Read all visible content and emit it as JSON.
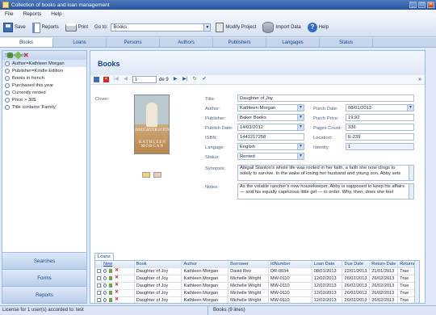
{
  "window": {
    "title": "Collection of books and loan management"
  },
  "menu": [
    "File",
    "Reports",
    "Help"
  ],
  "toolbar": {
    "save": "Save",
    "reports": "Reports",
    "print": "Print",
    "goto_label": "Go to:",
    "goto_value": "Books",
    "modify_project": "Modify Project",
    "import_data": "Import Data",
    "help": "Help"
  },
  "tabs": [
    "Books",
    "Loans",
    "Persons",
    "Authors",
    "Publishers",
    "Langages",
    "Status"
  ],
  "active_tab": "Books",
  "shortcuts": {
    "title": "ShortCuts",
    "items": [
      "Author=Kathleen Morgan",
      "Publisher=Kindle Edition",
      "Books in french",
      "Purchased this year",
      "Currently rented",
      "Price > 30$",
      "Title contains 'Family'"
    ],
    "selected_index": 0
  },
  "side_buttons": {
    "searches": "Searches",
    "forms": "Forms",
    "reports": "Reports"
  },
  "panel": {
    "title": "Books"
  },
  "nav": {
    "page": "1",
    "of": "de 9"
  },
  "book": {
    "cover_label": "Cover:",
    "cover_title_text": "DAUGHTER of JOY",
    "cover_author_text": "KATHLEEN MORGAN",
    "fields": {
      "title": {
        "label": "Title:",
        "value": "Daughter of Joy"
      },
      "author": {
        "label": "Author:",
        "value": "Kathleen Morgan"
      },
      "publisher": {
        "label": "Publisher:",
        "value": "Baker Books"
      },
      "publish_date": {
        "label": "Publish Date:",
        "value": "14/03/2012"
      },
      "isbn": {
        "label": "ISBN:",
        "value": "1441217258"
      },
      "language": {
        "label": "Langage:",
        "value": "English"
      },
      "status": {
        "label": "Status:",
        "value": "Rented"
      },
      "purch_date": {
        "label": "Purch Date:",
        "value": "08/01/2013"
      },
      "purch_price": {
        "label": "Purch Price:",
        "value": "19,92"
      },
      "pages_count": {
        "label": "Pages Count:",
        "value": "336"
      },
      "location": {
        "label": "Location:",
        "value": "E-239"
      },
      "identity": {
        "label": "Identity:",
        "value": "1"
      },
      "synopsis": {
        "label": "Synopsis:",
        "value": "Abigail Stanton's whole life was rooted in her faith, a faith she now clings to solely to survive. In the wake of losing her husband and young son, Abby sets"
      },
      "notes": {
        "label": "Notes:",
        "value": "As the volatile rancher's new housekeeper, Abby is supposed to keep his affairs — and his equally capricious little girl — in order. Why, then, does she feel"
      }
    }
  },
  "loans": {
    "tab_label": "Loans",
    "columns": [
      "",
      "New",
      "Book",
      "Author",
      "Borrower",
      "IdNumber",
      "Loan Date",
      "Due Date",
      "Return Date",
      "Returned"
    ],
    "rows": [
      [
        "Daughter of Joy",
        "Kathleen Morgan",
        "David Rev",
        "DR-0034",
        "08/01/2013",
        "22/01/2013",
        "21/01/2013",
        "True"
      ],
      [
        "Daughter of Joy",
        "Kathleen Morgan",
        "Michelle Wright",
        "MW-0110",
        "12/02/2013",
        "26/02/2013",
        "26/02/2013",
        "True"
      ],
      [
        "Daughter of Joy",
        "Kathleen Morgan",
        "Michelle Wright",
        "MW-0110",
        "12/02/2013",
        "26/02/2013",
        "26/02/2013",
        "True"
      ],
      [
        "Daughter of Joy",
        "Kathleen Morgan",
        "Michelle Wright",
        "MW-0110",
        "12/02/2013",
        "26/02/2013",
        "26/02/2013",
        "True"
      ],
      [
        "Daughter of Joy",
        "Kathleen Morgan",
        "Michelle Wright",
        "MW-0110",
        "12/02/2013",
        "26/02/2013",
        "26/02/2013",
        "True"
      ]
    ]
  },
  "status_bar": {
    "license": "License for 1 user(s) accorded to:  test",
    "records": "Books (9 lines)"
  }
}
